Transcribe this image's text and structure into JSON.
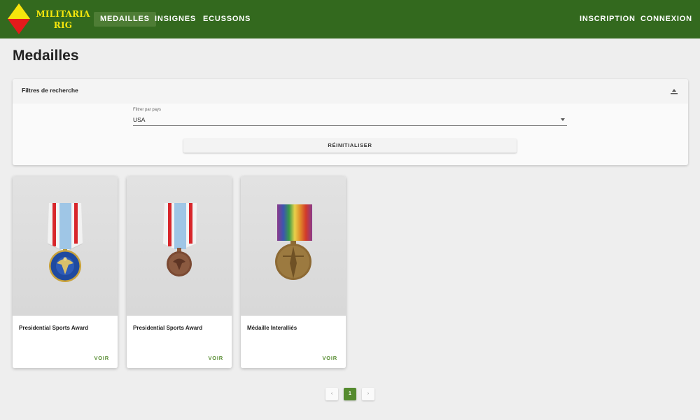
{
  "brand": {
    "line1": "MILITARIA",
    "line2": "RIG",
    "colors": {
      "bar": "#33691e",
      "logo_red": "#e31b1b",
      "logo_yellow": "#f5e60c"
    }
  },
  "nav": {
    "left": [
      {
        "label": "MEDAILLES",
        "active": true
      },
      {
        "label": "INSIGNES",
        "active": false
      },
      {
        "label": "ECUSSONS",
        "active": false
      }
    ],
    "right": [
      {
        "label": "INSCRIPTION"
      },
      {
        "label": "CONNEXION"
      }
    ]
  },
  "page": {
    "title": "Medailles"
  },
  "filters": {
    "title": "Filtres de recherche",
    "country_label": "Filtrer par pays",
    "country_value": "USA",
    "reset_label": "RÉINITIALISER"
  },
  "cards": [
    {
      "title": "Presidential Sports Award",
      "action": "VOIR",
      "image": "medal-blue-enamel"
    },
    {
      "title": "Presidential Sports Award",
      "action": "VOIR",
      "image": "medal-bronze"
    },
    {
      "title": "Médaille Interalliés",
      "action": "VOIR",
      "image": "medal-victory-rainbow"
    }
  ],
  "pagination": {
    "prev": "‹",
    "current": "1",
    "next": "›"
  },
  "accent": "#558b2f"
}
